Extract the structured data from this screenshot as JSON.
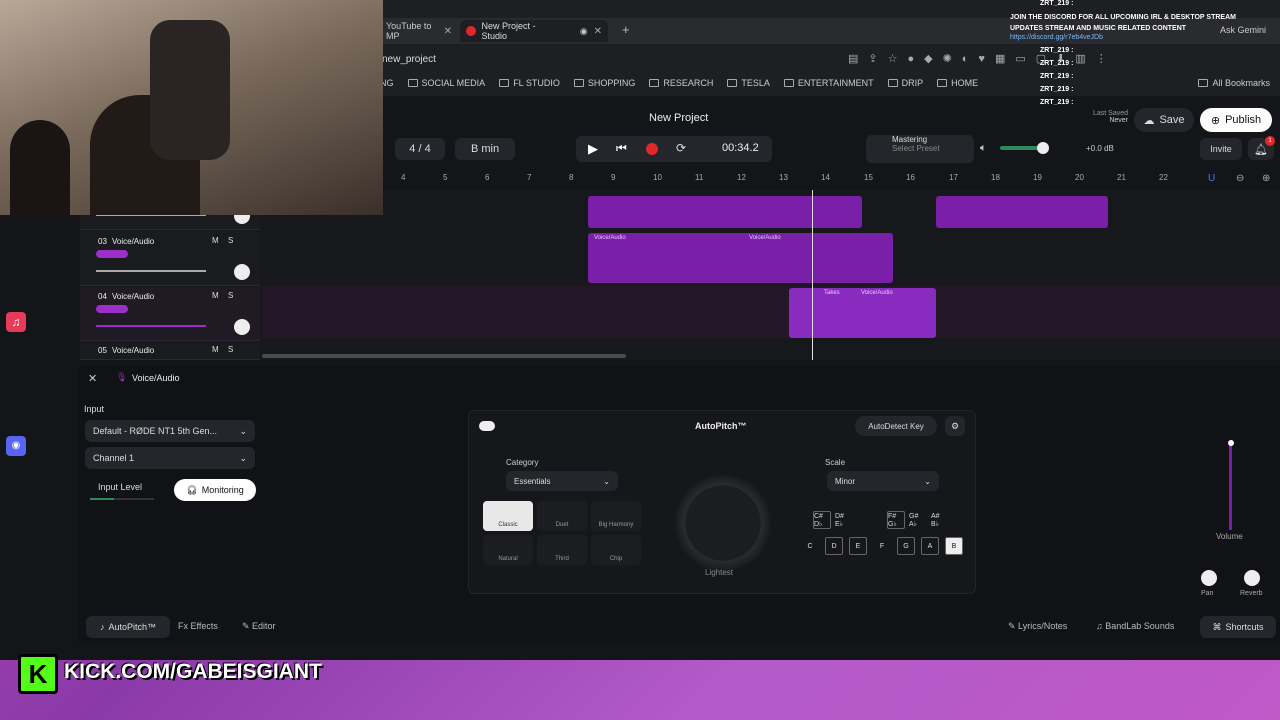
{
  "browser": {
    "tabs": [
      {
        "label": "YouTube to MP"
      },
      {
        "label": "New Project - Studio"
      }
    ],
    "url": "new_project",
    "bookmarks": [
      "NG",
      "SOCIAL MEDIA",
      "FL STUDIO",
      "SHOPPING",
      "RESEARCH",
      "TESLA",
      "ENTERTAINMENT",
      "DRIP",
      "HOME"
    ],
    "all_bookmarks": "All Bookmarks",
    "ask_gemini": "Ask Gemini"
  },
  "studio": {
    "project_title": "New Project",
    "time_signature": "4 / 4",
    "key": "B min",
    "time": "00:34.2",
    "mastering_label": "Mastering",
    "mastering_preset": "Select Preset",
    "volume_db": "+0.0 dB",
    "last_saved_label": "Last Saved",
    "last_saved_value": "Never",
    "save_label": "Save",
    "publish_label": "Publish",
    "invite_label": "Invite",
    "notification_count": "1",
    "ruler": [
      "4",
      "5",
      "6",
      "7",
      "8",
      "9",
      "10",
      "11",
      "12",
      "13",
      "14",
      "15",
      "16",
      "17",
      "18",
      "19",
      "20",
      "21",
      "22"
    ],
    "tracks": [
      {
        "num": "03",
        "name": "Voice/Audio",
        "m": "M",
        "s": "S"
      },
      {
        "num": "04",
        "name": "Voice/Audio",
        "m": "M",
        "s": "S"
      },
      {
        "num": "05",
        "name": "Voice/Audio",
        "m": "M",
        "s": "S"
      }
    ],
    "clip_labels": [
      "Voice/Audio",
      "Voice/Audio",
      "Takes",
      "Voice/Audio"
    ]
  },
  "panel": {
    "track_name": "Voice/Audio",
    "input_label": "Input",
    "input_device": "Default - RØDE NT1 5th Gen...",
    "channel": "Channel 1",
    "input_level_label": "Input Level",
    "monitoring_label": "Monitoring",
    "autopitch_title": "AutoPitch™",
    "autodetect_label": "AutoDetect Key",
    "category_label": "Category",
    "category_value": "Essentials",
    "scale_label": "Scale",
    "scale_value": "Minor",
    "styles": [
      "Classic",
      "Duet",
      "Big Harmony",
      "Natural",
      "Third",
      "Chip"
    ],
    "amount_label": "Lightest",
    "sharp_keys": [
      "C#\nD♭",
      "D#\nE♭",
      "F#\nG♭",
      "G#\nA♭",
      "A#\nB♭"
    ],
    "natural_keys": [
      "C",
      "D",
      "E",
      "F",
      "G",
      "A",
      "B"
    ],
    "volume_label": "Volume",
    "pan_label": "Pan",
    "reverb_label": "Reverb"
  },
  "bottom": {
    "tabs": [
      "AutoPitch™",
      "Effects",
      "Editor"
    ],
    "lyrics": "Lyrics/Notes",
    "sounds": "BandLab Sounds",
    "shortcuts": "Shortcuts"
  },
  "chat": {
    "lines": [
      "ZRT_219 :",
      "JOIN THE DISCORD FOR ALL UPCOMING IRL & DESKTOP STREAM UPDATES STREAM AND MUSIC RELATED CONTENT",
      "https://discord.gg/r7eb4veJDb",
      "ZRT_219 :",
      "ZRT_219 :",
      "ZRT_219 :",
      "ZRT_219 :",
      "ZRT_219 :"
    ]
  },
  "overlay": {
    "kick_url": "KICK.COM/GABEISGIANT"
  },
  "colors": {
    "accent": "#7a1fa8",
    "record": "#e0282a",
    "kick": "#53fc18"
  }
}
